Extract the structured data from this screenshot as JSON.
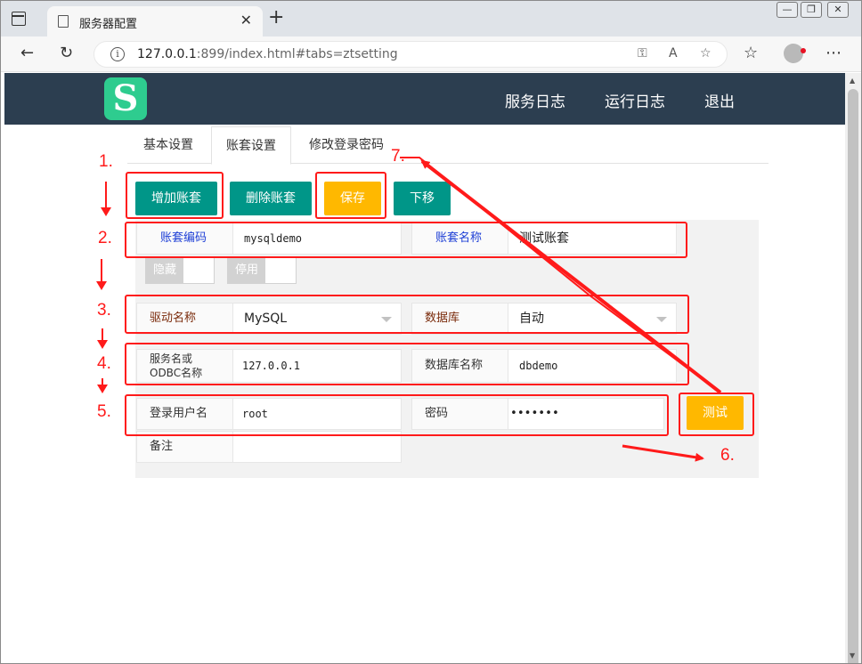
{
  "browser": {
    "tab_title": "服务器配置",
    "url_host": "127.0.0.1",
    "url_rest": ":899/index.html#tabs=ztsetting"
  },
  "app": {
    "logo_letter": "S",
    "menu": [
      "服务日志",
      "运行日志",
      "退出"
    ]
  },
  "page_tabs": [
    "基本设置",
    "账套设置",
    "修改登录密码"
  ],
  "active_tab": "账套设置",
  "buttons": {
    "add": "增加账套",
    "delete": "删除账套",
    "save": "保存",
    "move_down": "下移",
    "test": "测试"
  },
  "form": {
    "account_code_label": "账套编码",
    "account_code": "mysqldemo",
    "account_name_label": "账套名称",
    "account_name": "测试账套",
    "hide_label": "隐藏",
    "disable_label": "停用",
    "driver_label": "驱动名称",
    "driver": "MySQL",
    "database_label": "数据库",
    "database": "自动",
    "server_label_1": "服务名或",
    "server_label_2": "ODBC名称",
    "server": "127.0.0.1",
    "dbname_label": "数据库名称",
    "dbname": "dbdemo",
    "user_label": "登录用户名",
    "user": "root",
    "password_label": "密码",
    "password": "•••••••",
    "remark_label": "备注",
    "remark": ""
  },
  "annotations": [
    "1.",
    "2.",
    "3.",
    "4.",
    "5.",
    "6.",
    "7."
  ],
  "colors": {
    "header": "#2c3e50",
    "teal": "#009688",
    "yellow": "#ffb800",
    "annotation_red": "#ff1a1a"
  }
}
